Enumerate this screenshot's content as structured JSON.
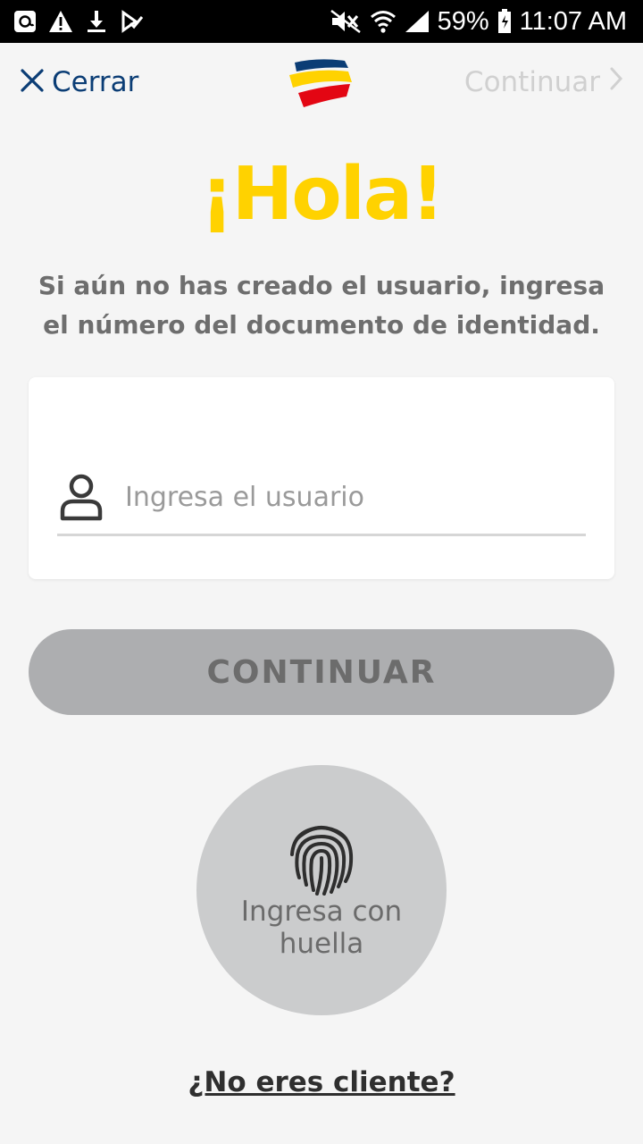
{
  "status_bar": {
    "battery": "59%",
    "time": "11:07 AM",
    "left_icons": [
      "at-icon",
      "warning-icon",
      "download-icon",
      "check-icon"
    ],
    "right_icons": [
      "mute-icon",
      "wifi-icon",
      "signal-icon",
      "battery-icon"
    ]
  },
  "header": {
    "close_label": "Cerrar",
    "continue_label": "Continuar"
  },
  "main": {
    "greeting": "¡Hola!",
    "subtitle": "Si aún no has creado el usuario, ingresa el número del documento de identidad.",
    "username_placeholder": "Ingresa el usuario",
    "username_value": "",
    "continue_button": "CONTINUAR",
    "fingerprint_label": "Ingresa con huella",
    "not_client_link": "¿No eres cliente?"
  },
  "colors": {
    "brand_blue": "#0b3d75",
    "brand_yellow": "#ffd200",
    "brand_red": "#e30613",
    "disabled_button": "#adaeb0"
  }
}
